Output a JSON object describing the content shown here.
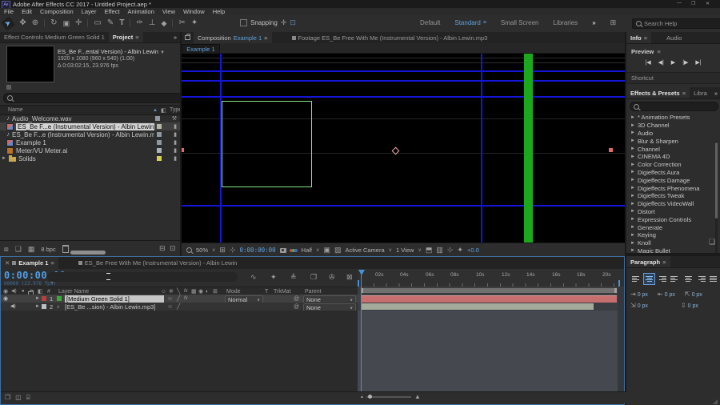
{
  "window": {
    "logo": "Ae",
    "title": "Adobe After Effects CC 2017 - Untitled Project.aep *",
    "menus": [
      "File",
      "Edit",
      "Composition",
      "Layer",
      "Effect",
      "Animation",
      "View",
      "Window",
      "Help"
    ],
    "controls": {
      "minimize": "—",
      "maximize": "❐",
      "close": "✕"
    }
  },
  "icons": {
    "menu": "≡",
    "overflow": "»",
    "chevron": "∨",
    "tri_right": "►",
    "tri_down": "▼",
    "sort_asc": "▲",
    "tag": "◧",
    "note": "♪",
    "close": "✕",
    "at": "@",
    "grid": "⊞",
    "safe": "⊹",
    "roi": "▣",
    "transp": "▨",
    "comp_mini": "▪",
    "eye": "◉",
    "speaker": "◀)",
    "solo": "●",
    "slash": "╱",
    "fx": "fx",
    "grip": "❏",
    "corner": "◢",
    "marker_bin": "▽",
    "mtn_small": "▴",
    "mtn_big": "▲",
    "workspace_bar": "⊞"
  },
  "toolbar": {
    "tools": [
      {
        "name": "selection",
        "glyph": "➤"
      },
      {
        "name": "hand",
        "glyph": "✥"
      },
      {
        "name": "zoom",
        "glyph": "⊕"
      },
      {
        "name": "orbit",
        "glyph": "↻"
      },
      {
        "name": "camera",
        "glyph": "▣"
      },
      {
        "name": "pan-behind",
        "glyph": "✛"
      },
      {
        "name": "rectangle",
        "glyph": "▭"
      },
      {
        "name": "pen",
        "glyph": "✎"
      },
      {
        "name": "type",
        "glyph": "T"
      },
      {
        "name": "brush",
        "glyph": "✑"
      },
      {
        "name": "clone-stamp",
        "glyph": "⊥"
      },
      {
        "name": "eraser",
        "glyph": "◆"
      },
      {
        "name": "roto-brush",
        "glyph": "✂"
      },
      {
        "name": "puppet-pin",
        "glyph": "✦"
      }
    ],
    "snapping": "Snapping",
    "snap_icons": [
      "✛",
      "⊡"
    ],
    "workspaces": [
      "Default",
      "Standard",
      "Small Screen",
      "Libraries"
    ],
    "active_workspace": "Standard",
    "search_placeholder": "Search Help"
  },
  "project": {
    "tabs": {
      "effect_controls": "Effect Controls Medium Green Solid 1",
      "project": "Project"
    },
    "preview": {
      "name": "ES_Be F...ental Version) - Albin Lewin",
      "dims": "1920 x 1080   (960 x 540) (1.00)",
      "duration": "Δ 0:03:02:15, 23.976 fps"
    },
    "columns": {
      "name": "Name",
      "type": "Type"
    },
    "items": [
      {
        "name": "Audio_Welcome.wav",
        "kind": "audio"
      },
      {
        "name": "ES_Be F...e (Instrumental Version) - Albin Lewin",
        "kind": "comp"
      },
      {
        "name": "ES_Be F...e (Instrumental Version) - Albin Lewin.mp3",
        "kind": "audio"
      },
      {
        "name": "Example 1",
        "kind": "comp"
      },
      {
        "name": "Meter/VU Meter.ai",
        "kind": "ai"
      },
      {
        "name": "Solids",
        "kind": "folder"
      }
    ],
    "footer": {
      "bpc": "8 bpc"
    }
  },
  "viewer": {
    "tabs": {
      "comp_label": "Composition",
      "comp_name": "Example 1",
      "footage": "Footage ES_Be Free With Me (Instrumental Version) - Albin Lewin.mp3"
    },
    "quick_tab": "Example 1",
    "controls": {
      "zoom": "50%",
      "timecode": "0:00:00:00",
      "resolution": "Half",
      "camera": "Active Camera",
      "view": "1 View",
      "exposure": "+0.0",
      "extra_icons": [
        "⬒",
        "▥",
        "⊹",
        "✦"
      ]
    }
  },
  "right": {
    "tabs": {
      "info": "Info",
      "audio": "Audio"
    },
    "preview": {
      "title": "Preview",
      "buttons": [
        "|◀",
        "◀|",
        "▶",
        "|▶",
        "▶|"
      ]
    },
    "shortcut": "Shortcut",
    "fx_tabs": {
      "effects": "Effects & Presets",
      "libraries": "Libra"
    },
    "categories": [
      "* Animation Presets",
      "3D Channel",
      "Audio",
      "Blur & Sharpen",
      "Channel",
      "CINEMA 4D",
      "Color Correction",
      "Digieffects Aura",
      "Digieffects Damage",
      "Digieffects Phenomena",
      "Digieffects Tweak",
      "Digieffects VideoWall",
      "Distort",
      "Expression Controls",
      "Generate",
      "Keying",
      "Knoll",
      "Magic Bullet"
    ]
  },
  "paragraph": {
    "title": "Paragraph",
    "value": "0 px",
    "indent_icons": [
      "⇥",
      "⇤",
      "⇱",
      "⇲",
      "⇳"
    ]
  },
  "timeline": {
    "tabs": {
      "active": "Example 1",
      "inactive": "ES_Be Free With Me (Instrumental Version) - Albin Lewin"
    },
    "timecode": "0:00:00:00",
    "frames": "00000 (23.976 fps)",
    "toolbar_icons": [
      "∿",
      "✦",
      "≜",
      "❐",
      "✇",
      "⊠"
    ],
    "columns": {
      "num": "#",
      "layer_name": "Layer Name",
      "mode": "Mode",
      "trkmat_t": "T",
      "trkmat": "TrkMat",
      "parent": "Parent"
    },
    "switch_icons": [
      "☺",
      "❈",
      "╲",
      "fx",
      "▦",
      "◉",
      "◐",
      "⊞"
    ],
    "layers": [
      {
        "num": "1",
        "name": "[Medium Green Solid 1]",
        "mode": "Normal",
        "parent": "None"
      },
      {
        "num": "2",
        "name": "[ES_Be ...sion) - Albin Lewin.mp3]",
        "parent": "None"
      }
    ],
    "ticks": [
      "02s",
      "04s",
      "06s",
      "08s",
      "10s",
      "12s",
      "14s",
      "16s",
      "18s",
      "20s"
    ],
    "footer_icons": [
      "❐",
      "◫",
      "⌸"
    ]
  },
  "colors": {
    "accent_blue": "#4a90d9",
    "timecode_blue": "#4f9fe8",
    "guide_blue": "#1515d8",
    "solid_bar_red": "#c76f6f",
    "audio_bar": "#a4ab9b",
    "comp_green_bar": "#1ca81c",
    "rect_outline_green": "#86e386",
    "label_yellow": "#d6cf5a"
  }
}
